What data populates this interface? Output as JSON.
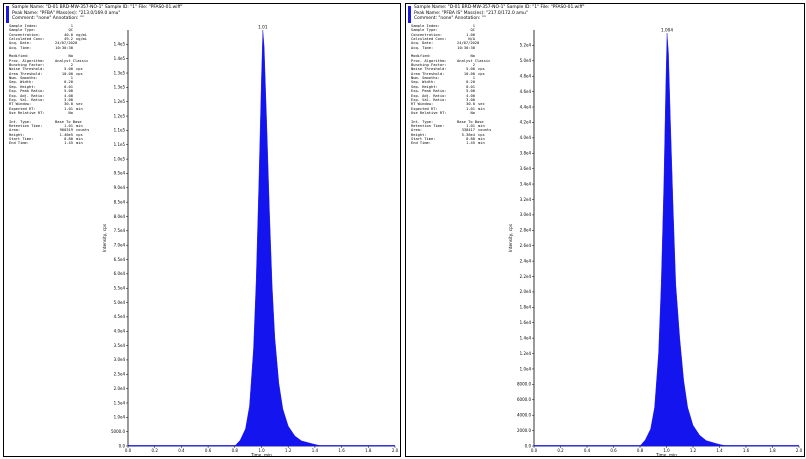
{
  "chart_data": [
    {
      "type": "area",
      "header": {
        "line1": "Sample Name: \"D-01 BRD-MW-357-NO-1\"  Sample ID: \"1\"   File: \"PFAS0-01.wiff\"",
        "line2": "Peak Name: \"PFBA\"   Mass(es): \"213.0/169.0 amu\"",
        "line3": "Comment: \"none\"   Annotation: \"\""
      },
      "params": [
        {
          "k": "Sample Index:",
          "v": "1",
          "u": ""
        },
        {
          "k": "Sample Type:",
          "v": "QC",
          "u": ""
        },
        {
          "k": "Concentration:",
          "v": "40.0",
          "u": "ng/mL"
        },
        {
          "k": "Calculated Conc:",
          "v": "49.2",
          "u": "ng/mL"
        },
        {
          "k": "Acq. Date:",
          "v": "24/07/2020",
          "u": ""
        },
        {
          "k": "Acq. Time:",
          "v": "10:30:30",
          "u": ""
        },
        {
          "gap": true
        },
        {
          "k": "Modified:",
          "v": "No",
          "u": ""
        },
        {
          "k": "Proc. Algorithm:",
          "v": "Analyst Classic",
          "u": ""
        },
        {
          "k": "Bunching Factor:",
          "v": "2",
          "u": ""
        },
        {
          "k": "Noise Threshold:",
          "v": "5.00",
          "u": "cps"
        },
        {
          "k": "Area Threshold:",
          "v": "10.00",
          "u": "cps"
        },
        {
          "k": "Num. Smooths:",
          "v": "1",
          "u": ""
        },
        {
          "k": "Sep. Width:",
          "v": "0.20",
          "u": ""
        },
        {
          "k": "Sep. Height:",
          "v": "0.01",
          "u": ""
        },
        {
          "k": "Exp. Peak Ratio:",
          "v": "5.00",
          "u": ""
        },
        {
          "k": "Exp. Adj. Ratio:",
          "v": "4.00",
          "u": ""
        },
        {
          "k": "Exp. Val. Ratio:",
          "v": "3.00",
          "u": ""
        },
        {
          "k": "RT Window:",
          "v": "30.0",
          "u": "sec"
        },
        {
          "k": "Expected RT:",
          "v": "1.01",
          "u": "min"
        },
        {
          "k": "Use Relative RT:",
          "v": "No",
          "u": ""
        },
        {
          "gap": true
        },
        {
          "k": "Int. Type:",
          "v": "Base To Base",
          "u": ""
        },
        {
          "k": "Retention Time:",
          "v": "1.01",
          "u": "min"
        },
        {
          "k": "Area:",
          "v": "960319",
          "u": "counts"
        },
        {
          "k": "Height:",
          "v": "1.46e5",
          "u": "cps"
        },
        {
          "k": "Start Time:",
          "v": "0.80",
          "u": "min"
        },
        {
          "k": "End Time:",
          "v": "1.45",
          "u": "min"
        }
      ],
      "peak_label": "1.01",
      "ylabel": "Intensity, cps",
      "xlabel": "Time, min",
      "xlim": [
        0,
        2.0
      ],
      "ylim": [
        0,
        146000
      ],
      "x_ticks": [
        "0.0",
        "0.2",
        "0.4",
        "0.6",
        "0.8",
        "1.0",
        "1.2",
        "1.4",
        "1.6",
        "1.8",
        "2.0"
      ],
      "y_ticks": [
        "0.0",
        "5000.0",
        "1.0e4",
        "1.5e4",
        "2.0e4",
        "2.5e4",
        "3.0e4",
        "3.5e4",
        "4.0e4",
        "4.5e4",
        "5.0e4",
        "5.5e4",
        "6.0e4",
        "6.5e4",
        "7.0e4",
        "7.5e4",
        "8.0e4",
        "8.5e4",
        "9.0e4",
        "9.5e4",
        "1.0e5",
        "1.1e5",
        "1.1e5",
        "1.2e5",
        "1.2e5",
        "1.3e5",
        "1.3e5",
        "1.4e5",
        "1.4e5"
      ],
      "fill_color": "#1414ee",
      "x": [
        0.0,
        0.8,
        0.84,
        0.88,
        0.91,
        0.94,
        0.96,
        0.98,
        1.0,
        1.01,
        1.02,
        1.04,
        1.06,
        1.08,
        1.1,
        1.13,
        1.16,
        1.2,
        1.25,
        1.3,
        1.38,
        1.45,
        1.6,
        1.8,
        2.0
      ],
      "y": [
        0,
        0,
        2000,
        6000,
        14000,
        34000,
        58000,
        92000,
        130000,
        146000,
        140000,
        112000,
        82000,
        56000,
        38000,
        22000,
        13000,
        7000,
        3500,
        1800,
        800,
        0,
        0,
        0,
        0
      ]
    },
    {
      "type": "area",
      "header": {
        "line1": "Sample Name: \"D-01 BRD-MW-357-NO-1\"  Sample ID: \"1\"   File: \"PFAS0-01.wiff\"",
        "line2": "Peak Name: \"PFBA IS\"   Mass(es): \"217.0/172.0 amu\"",
        "line3": "Comment: \"none\"   Annotation: \"\""
      },
      "params": [
        {
          "k": "Sample Index:",
          "v": "1",
          "u": ""
        },
        {
          "k": "Sample Type:",
          "v": "QC",
          "u": ""
        },
        {
          "k": "Concentration:",
          "v": "1.00",
          "u": ""
        },
        {
          "k": "Calculated Conc:",
          "v": "N/A",
          "u": ""
        },
        {
          "k": "Acq. Date:",
          "v": "24/07/2020",
          "u": ""
        },
        {
          "k": "Acq. Time:",
          "v": "10:30:30",
          "u": ""
        },
        {
          "gap": true
        },
        {
          "k": "Modified:",
          "v": "No",
          "u": ""
        },
        {
          "k": "Proc. Algorithm:",
          "v": "Analyst Classic",
          "u": ""
        },
        {
          "k": "Bunching Factor:",
          "v": "2",
          "u": ""
        },
        {
          "k": "Noise Threshold:",
          "v": "5.00",
          "u": "cps"
        },
        {
          "k": "Area Threshold:",
          "v": "10.00",
          "u": "cps"
        },
        {
          "k": "Num. Smooths:",
          "v": "1",
          "u": ""
        },
        {
          "k": "Sep. Width:",
          "v": "0.20",
          "u": ""
        },
        {
          "k": "Sep. Height:",
          "v": "0.01",
          "u": ""
        },
        {
          "k": "Exp. Peak Ratio:",
          "v": "5.00",
          "u": ""
        },
        {
          "k": "Exp. Adj. Ratio:",
          "v": "4.00",
          "u": ""
        },
        {
          "k": "Exp. Val. Ratio:",
          "v": "3.00",
          "u": ""
        },
        {
          "k": "RT Window:",
          "v": "30.0",
          "u": "sec"
        },
        {
          "k": "Expected RT:",
          "v": "1.01",
          "u": "min"
        },
        {
          "k": "Use Relative RT:",
          "v": "No",
          "u": ""
        },
        {
          "gap": true
        },
        {
          "k": "Int. Type:",
          "v": "Base To Base",
          "u": ""
        },
        {
          "k": "Retention Time:",
          "v": "1.01",
          "u": "min"
        },
        {
          "k": "Area:",
          "v": "338417",
          "u": "counts"
        },
        {
          "k": "Height:",
          "v": "5.36e4",
          "u": "cps"
        },
        {
          "k": "Start Time:",
          "v": "0.80",
          "u": "min"
        },
        {
          "k": "End Time:",
          "v": "1.45",
          "u": "min"
        }
      ],
      "peak_label": "1.004",
      "ylabel": "Intensity, cps",
      "xlabel": "Time, min",
      "xlim": [
        0,
        2.0
      ],
      "ylim": [
        0,
        54000
      ],
      "x_ticks": [
        "0.0",
        "0.2",
        "0.4",
        "0.6",
        "0.8",
        "1.0",
        "1.2",
        "1.4",
        "1.6",
        "1.8",
        "2.0"
      ],
      "y_ticks": [
        "0.0",
        "2000.0",
        "4000.0",
        "6000.0",
        "8000.0",
        "1.0e4",
        "1.2e4",
        "1.4e4",
        "1.6e4",
        "1.8e4",
        "2.0e4",
        "2.2e4",
        "2.4e4",
        "2.6e4",
        "2.8e4",
        "3.0e4",
        "3.2e4",
        "3.4e4",
        "3.6e4",
        "3.8e4",
        "4.0e4",
        "4.2e4",
        "4.4e4",
        "4.6e4",
        "4.8e4",
        "5.0e4",
        "5.2e4"
      ],
      "fill_color": "#1414ee",
      "x": [
        0.0,
        0.8,
        0.84,
        0.88,
        0.91,
        0.94,
        0.96,
        0.98,
        0.995,
        1.004,
        1.015,
        1.03,
        1.05,
        1.07,
        1.1,
        1.13,
        1.16,
        1.2,
        1.25,
        1.3,
        1.38,
        1.45,
        1.6,
        1.8,
        2.0
      ],
      "y": [
        0,
        0,
        800,
        2200,
        5000,
        12000,
        21000,
        34000,
        47000,
        53600,
        51000,
        42000,
        31000,
        21000,
        14000,
        8500,
        5000,
        2700,
        1400,
        700,
        300,
        0,
        0,
        0,
        0
      ]
    }
  ]
}
